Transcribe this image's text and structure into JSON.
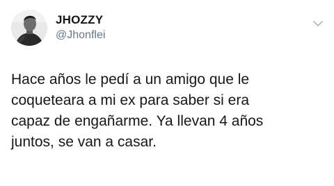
{
  "tweet": {
    "display_name": "JHOZZY",
    "handle": "@Jhonflei",
    "text": "Hace años le pedí a un amigo que le\ncoqueteara a mi ex para saber si era\ncapaz de engañarme. Ya llevan 4 años\njuntos, se van a casar.",
    "avatar_icon": "user-avatar",
    "menu_icon": "chevron-down-icon"
  }
}
